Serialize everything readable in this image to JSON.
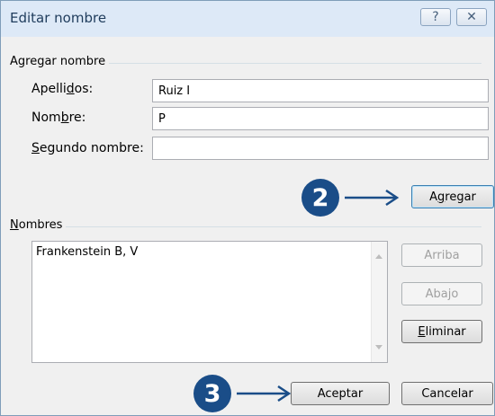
{
  "window": {
    "title": "Editar nombre",
    "help_glyph": "?",
    "close_glyph": "✕"
  },
  "group_add": {
    "label": "Agregar nombre"
  },
  "fields": [
    {
      "label_pre": "Apelli",
      "label_key": "d",
      "label_post": "os:",
      "value": "Ruiz I"
    },
    {
      "label_pre": "Nom",
      "label_key": "b",
      "label_post": "re:",
      "value": "P"
    },
    {
      "label_pre": "",
      "label_key": "S",
      "label_post": "egundo nombre:",
      "value": ""
    }
  ],
  "buttons": {
    "agregar": {
      "pre": "A",
      "key": "g",
      "post": "regar"
    },
    "arriba": "Arriba",
    "abajo": "Abajo",
    "eliminar": {
      "pre": "",
      "key": "E",
      "post": "liminar"
    },
    "aceptar": "Aceptar",
    "cancelar": "Cancelar"
  },
  "group_names": {
    "pre": "",
    "key": "N",
    "post": "ombres"
  },
  "names_list": [
    "Frankenstein B, V"
  ],
  "callouts": [
    {
      "number": "2",
      "target": "agregar-button"
    },
    {
      "number": "3",
      "target": "aceptar-button"
    }
  ],
  "colors": {
    "badge": "#1a4d88",
    "accent": "#3c7fb1"
  }
}
